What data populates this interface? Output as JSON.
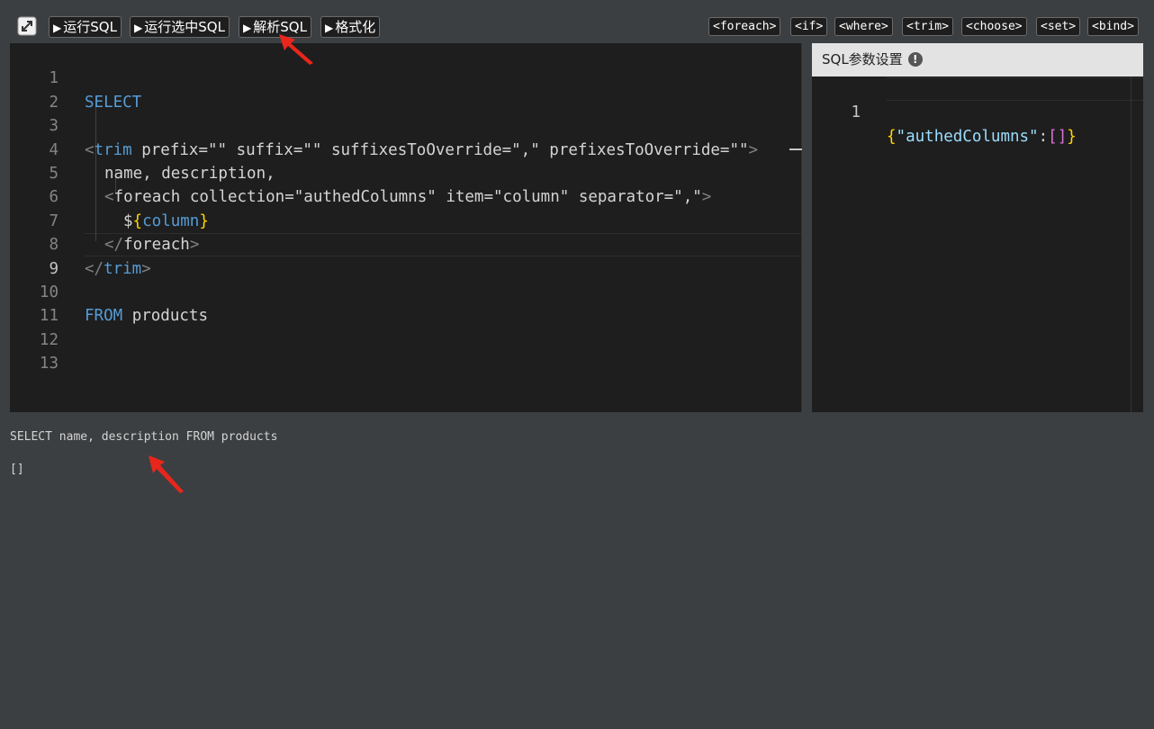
{
  "toolbar": {
    "buttons": [
      {
        "label": "运行SQL"
      },
      {
        "label": "运行选中SQL"
      },
      {
        "label": "解析SQL"
      },
      {
        "label": "格式化"
      }
    ],
    "tags": [
      "<foreach>",
      "<if>",
      "<where>",
      "<trim>",
      "<choose>",
      "<set>",
      "<bind>"
    ]
  },
  "editor": {
    "line_numbers": [
      "1",
      "2",
      "3",
      "4",
      "5",
      "6",
      "7",
      "8",
      "9",
      "10",
      "11",
      "12",
      "13"
    ],
    "active_line": 9,
    "lines": {
      "l1_kw": "SELECT",
      "l3_open": "<",
      "l3_tag": "trim",
      "l3_attrs": " prefix=\"\" suffix=\"\" suffixesToOverride=\",\" prefixesToOverride=\"\"",
      "l3_close": ">",
      "l4_text": "name, description,",
      "l5_open": "<",
      "l5_tag": "foreach",
      "l5_attrs": " collection=\"authedColumns\" item=\"column\" separator=\",\"",
      "l5_close": ">",
      "l6_dollar": "$",
      "l6_lbrace": "{",
      "l6_var": "column",
      "l6_rbrace": "}",
      "l7_open": "</",
      "l7_tag": "foreach",
      "l7_close": ">",
      "l8_open": "</",
      "l8_tag": "trim",
      "l8_close": ">",
      "l10_kw": "FROM",
      "l10_text": " products"
    }
  },
  "params": {
    "title": "SQL参数设置",
    "info_icon": "!",
    "line_number": "1",
    "json_lbrace": "{",
    "json_key": "\"authedColumns\"",
    "json_colon": ":",
    "json_lbracket": "[",
    "json_rbracket": "]",
    "json_rbrace": "}"
  },
  "output": {
    "sql": "SELECT name, description FROM products",
    "params": "[]"
  },
  "colors": {
    "keyword": "#569cd6",
    "annotation_arrow": "#e8261c"
  }
}
